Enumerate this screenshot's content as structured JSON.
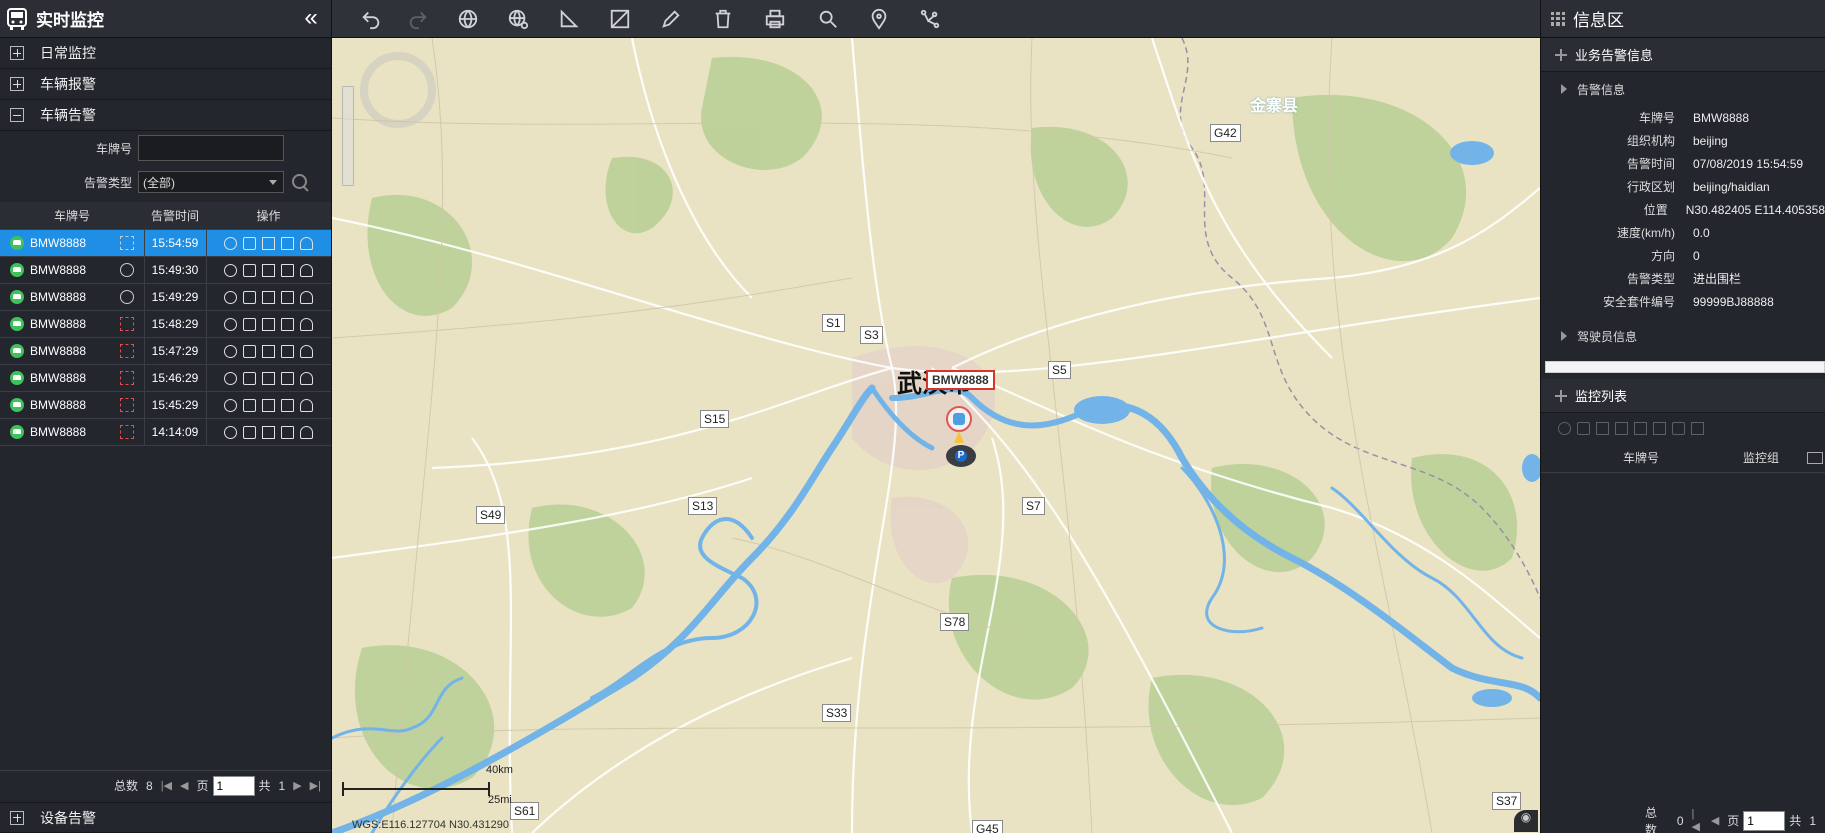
{
  "left": {
    "title": "实时监控",
    "sections": [
      "日常监控",
      "车辆报警",
      "车辆告警"
    ],
    "form": {
      "plate_label": "车牌号",
      "plate_value": "",
      "type_label": "告警类型",
      "type_value": "(全部)"
    },
    "table": {
      "headers": [
        "车牌号",
        "告警时间",
        "操作"
      ],
      "rows": [
        {
          "plate": "BMW8888",
          "type_icon": "fence-icon",
          "time": "15:54:59",
          "selected": true
        },
        {
          "plate": "BMW8888",
          "type_icon": "speed-gauge-icon",
          "time": "15:49:30"
        },
        {
          "plate": "BMW8888",
          "type_icon": "route-icon",
          "time": "15:49:29"
        },
        {
          "plate": "BMW8888",
          "type_icon": "fence-alert-icon",
          "time": "15:48:29"
        },
        {
          "plate": "BMW8888",
          "type_icon": "fence-alert-icon",
          "time": "15:47:29"
        },
        {
          "plate": "BMW8888",
          "type_icon": "fence-alert-icon",
          "time": "15:46:29"
        },
        {
          "plate": "BMW8888",
          "type_icon": "fence-alert-icon",
          "time": "15:45:29"
        },
        {
          "plate": "BMW8888",
          "type_icon": "fence-alert-icon",
          "time": "14:14:09"
        }
      ],
      "op_icons": [
        "play-icon",
        "camera-icon",
        "film-icon",
        "document-icon",
        "person-icon"
      ]
    },
    "pager": {
      "total_label": "总数",
      "total": "8",
      "page_label": "页",
      "page_value": "1",
      "of_label": "共",
      "of_value": "1"
    },
    "bottom_section": "设备告警"
  },
  "toolbar": {
    "icons": [
      "undo-icon",
      "redo-icon",
      "globe-icon",
      "globe-settings-icon",
      "measure-angle-icon",
      "measure-area-icon",
      "pencil-icon",
      "trash-icon",
      "printer-icon",
      "search-icon",
      "location-pin-icon",
      "route-path-icon"
    ]
  },
  "map": {
    "city": "武汉市",
    "county": "金寨县",
    "plate_label": "BMW8888",
    "road_labels": [
      "G42",
      "S1",
      "S3",
      "S5",
      "S15",
      "S13",
      "S49",
      "S7",
      "S78",
      "S33",
      "S61",
      "G45",
      "S37"
    ],
    "scale_km": "40km",
    "scale_mi": "25mi",
    "coords": "WGS:E116.127704   N30.431290",
    "colors": {
      "land": "#e9e3c3",
      "water": "#72b4e8",
      "green": "#a9c58a",
      "road": "#ffffff"
    }
  },
  "right": {
    "title": "信息区",
    "section1": "业务告警信息",
    "sub1": "告警信息",
    "fields": [
      {
        "k": "车牌号",
        "v": "BMW8888"
      },
      {
        "k": "组织机构",
        "v": "beijing"
      },
      {
        "k": "告警时间",
        "v": "07/08/2019 15:54:59"
      },
      {
        "k": "行政区划",
        "v": "beijing/haidian"
      },
      {
        "k": "位置",
        "v": "N30.482405 E114.405358"
      },
      {
        "k": "速度(km/h)",
        "v": "0.0"
      },
      {
        "k": "方向",
        "v": "0"
      },
      {
        "k": "告警类型",
        "v": "进出围栏"
      },
      {
        "k": "安全套件编号",
        "v": "99999BJ88888"
      }
    ],
    "sub2": "驾驶员信息",
    "section2": "监控列表",
    "list_headers": [
      "车牌号",
      "监控组"
    ],
    "pager": {
      "total_label": "总数",
      "total": "0",
      "page_label": "页",
      "page_value": "1",
      "of_label": "共",
      "of_value": "1"
    }
  }
}
